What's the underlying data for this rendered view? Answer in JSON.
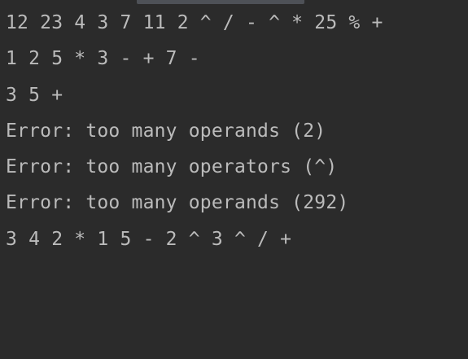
{
  "console": {
    "lines": [
      "12 23 4 3 7 11 2 ^ / - ^ * 25 % +",
      "1 2 5 * 3 - + 7 -",
      "3 5 +",
      "Error: too many operands (2)",
      "Error: too many operators (^)",
      "Error: too many operands (292)",
      "3 4 2 * 1 5 - 2 ^ 3 ^ / +"
    ]
  },
  "colors": {
    "background": "#2b2b2b",
    "text": "#bbbbbb",
    "scrollbar": "#4e5157"
  }
}
